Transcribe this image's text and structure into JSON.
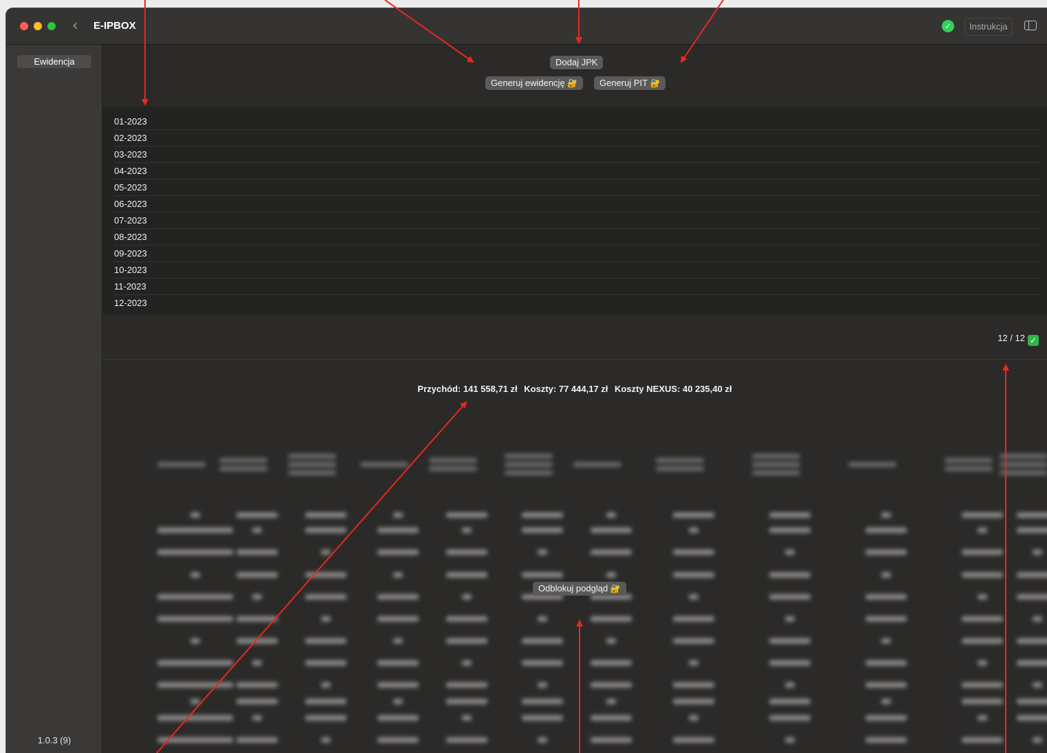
{
  "window": {
    "title": "E-IPBOX"
  },
  "toolbar": {
    "instructions_label": "Instrukcja",
    "status_icon": "check-circle-icon",
    "back_icon": "chevron-left-icon",
    "sidebar_toggle_icon": "sidebar-toggle-icon"
  },
  "sidebar": {
    "items": [
      {
        "label": "Ewidencja"
      }
    ],
    "version": "1.0.3 (9)"
  },
  "actions": {
    "add_jpk": "Dodaj JPK",
    "generate_register": "Generuj ewidencję",
    "generate_pit": "Generuj PIT",
    "lock_icon": "🔐"
  },
  "months": [
    "01-2023",
    "02-2023",
    "03-2023",
    "04-2023",
    "05-2023",
    "06-2023",
    "07-2023",
    "08-2023",
    "09-2023",
    "10-2023",
    "11-2023",
    "12-2023"
  ],
  "progress": {
    "label": "12 / 12",
    "icon": "✅"
  },
  "summary": {
    "revenue": "Przychód: 141 558,71 zł",
    "costs": "Koszty: 77 444,17 zł",
    "nexus_costs": "Koszty NEXUS: 40 235,40 zł"
  },
  "preview": {
    "unlock_label": "Odblokuj podgląd"
  },
  "colors": {
    "arrow": "#e8291c",
    "accent_green": "#2fd158"
  }
}
